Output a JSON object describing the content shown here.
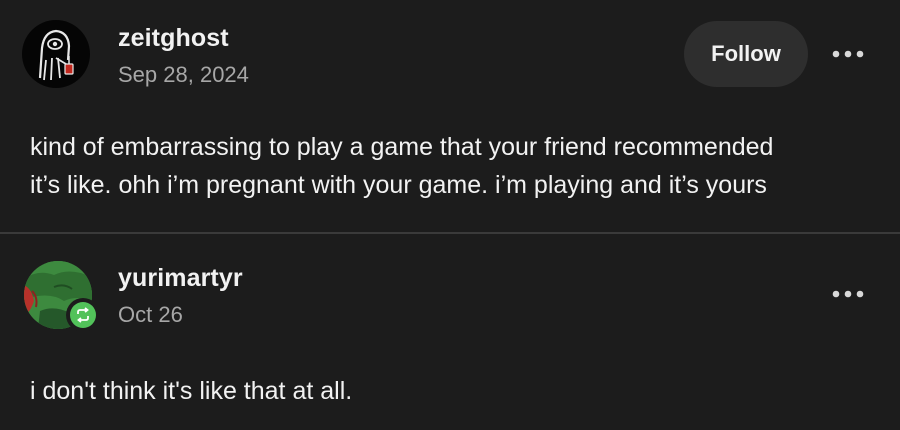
{
  "posts": [
    {
      "username": "zeitghost",
      "date": "Sep 28, 2024",
      "follow_label": "Follow",
      "avatar_icon": "reaper-holding-lantern-icon",
      "more_icon": "more-dots-icon",
      "body_lines": [
        "kind of embarrassing to play a game that your friend recommended",
        "it’s like. ohh i’m pregnant with your game. i’m playing and it’s yours"
      ]
    },
    {
      "username": "yurimartyr",
      "date": "Oct 26",
      "avatar_icon": "green-character-avatar-icon",
      "badge_icon": "reblog-icon",
      "more_icon": "more-dots-icon",
      "body_lines": [
        "i don't think it's like that at all."
      ]
    }
  ],
  "colors": {
    "background": "#1c1c1c",
    "button": "#2e2e2e",
    "reblog_green": "#52c25a",
    "muted_text": "#a7a7a7",
    "divider": "#3a3a3a"
  }
}
